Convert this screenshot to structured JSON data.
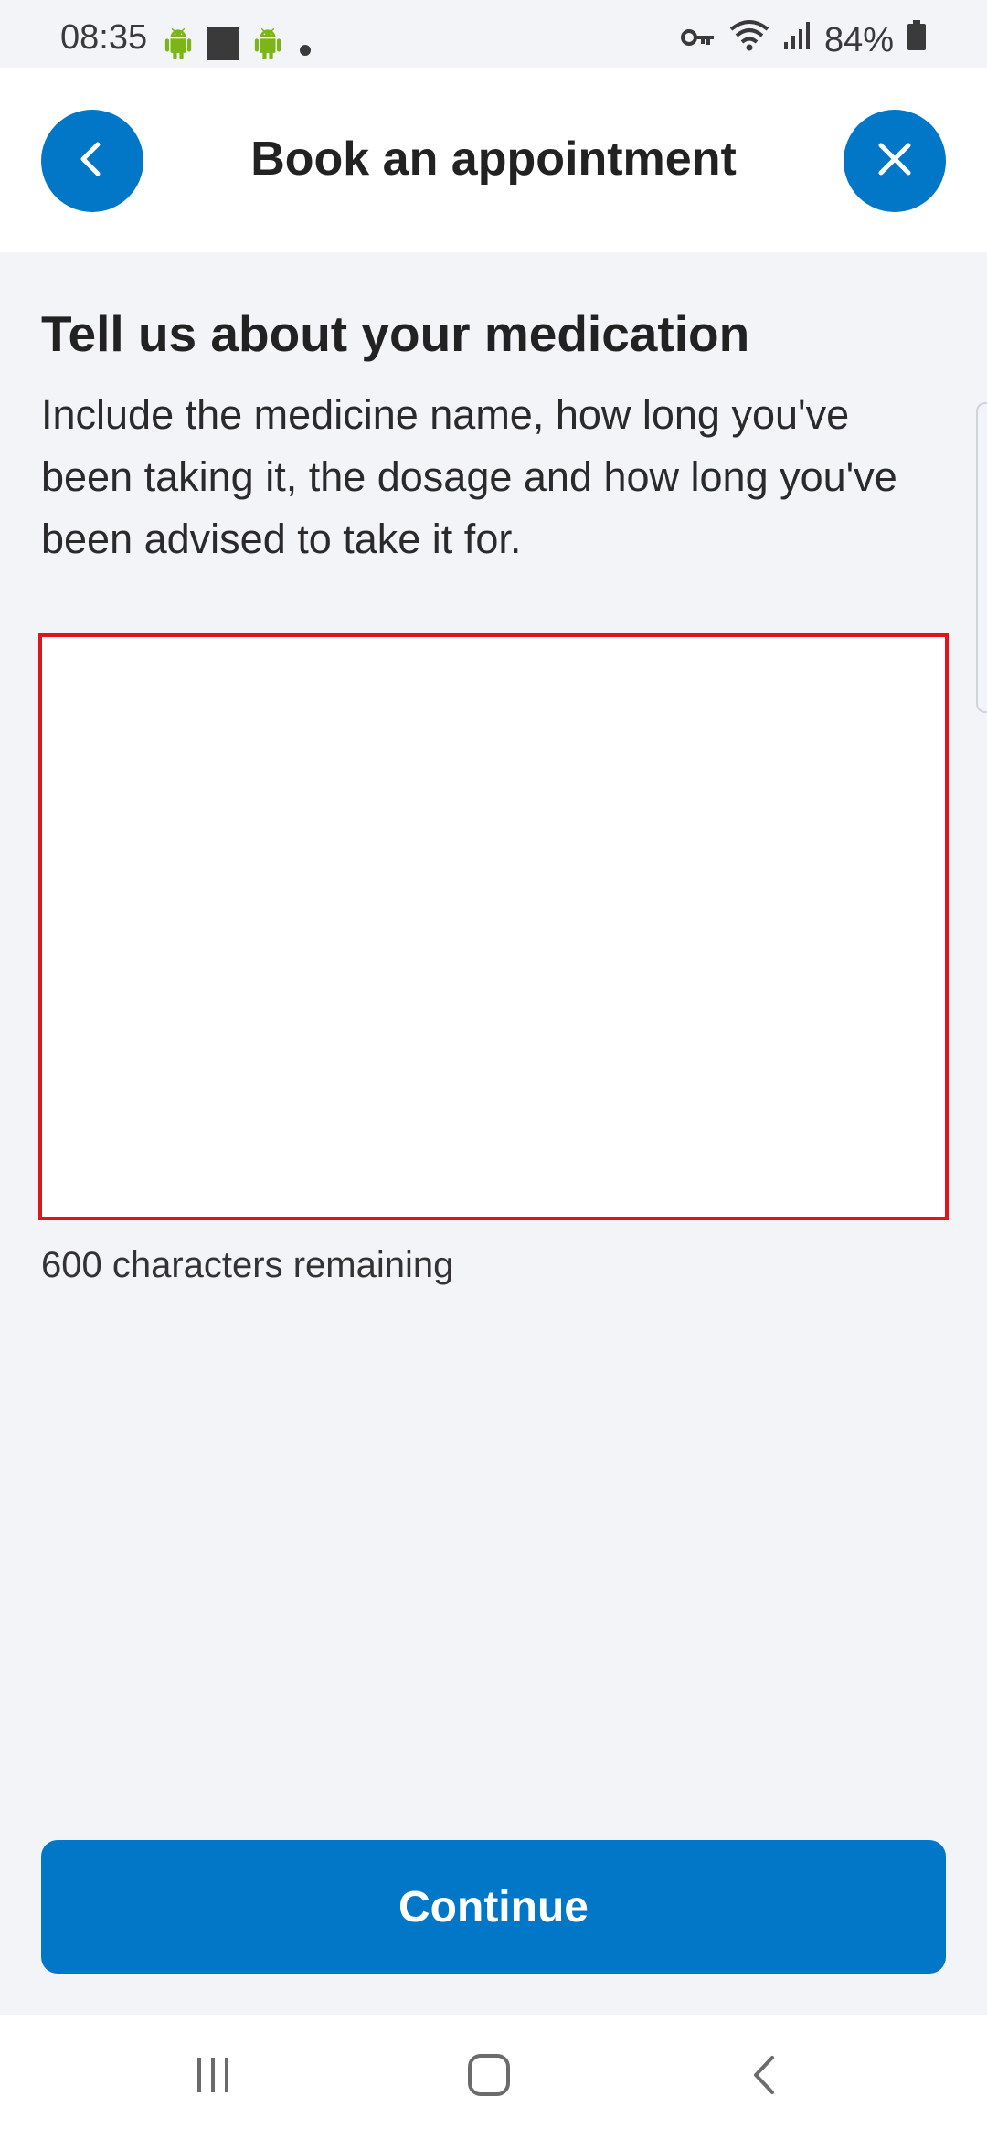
{
  "status_bar": {
    "time": "08:35",
    "battery": "84%",
    "icons": [
      "android-icon",
      "square-notification-icon",
      "android-icon",
      "dot-icon",
      "key-icon",
      "wifi-icon",
      "signal-icon",
      "battery-icon"
    ]
  },
  "header": {
    "title": "Book an appointment",
    "back_icon": "chevron-left-icon",
    "close_icon": "close-icon"
  },
  "main": {
    "title": "Tell us about your medication",
    "description": "Include the medicine name, how long you've been taking it, the dosage and how long you've been advised to take it for.",
    "textarea_value": "",
    "char_count": "600 characters remaining",
    "continue_label": "Continue"
  },
  "nav_bar": {
    "icons": [
      "recents-icon",
      "home-icon",
      "back-icon"
    ]
  },
  "colors": {
    "accent": "#0277c8",
    "background": "#f2f4f8",
    "header_bg": "#ffffff",
    "highlight_border": "#e0151c",
    "android_green": "#7cb518"
  }
}
